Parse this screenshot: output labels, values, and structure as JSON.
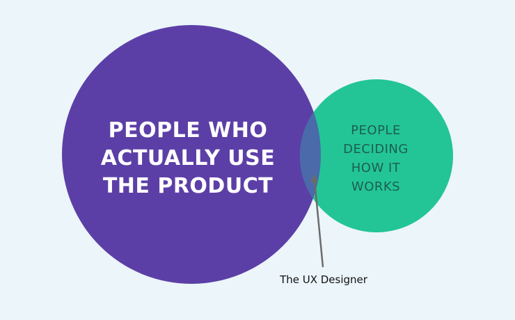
{
  "venn": {
    "left_set_label": "PEOPLE WHO\nACTUALLY USE\nTHE PRODUCT",
    "right_set_label": "PEOPLE\nDECIDING\nHOW IT\nWORKS",
    "overlap_annotation": "The UX Designer"
  },
  "colors": {
    "background": "#ebf5fa",
    "left_circle": "#5c3fa6",
    "right_circle": "#23c596",
    "overlap": "#4a6aaa",
    "right_label_text": "#1d5f4c",
    "arrow": "#6b6b6b"
  }
}
